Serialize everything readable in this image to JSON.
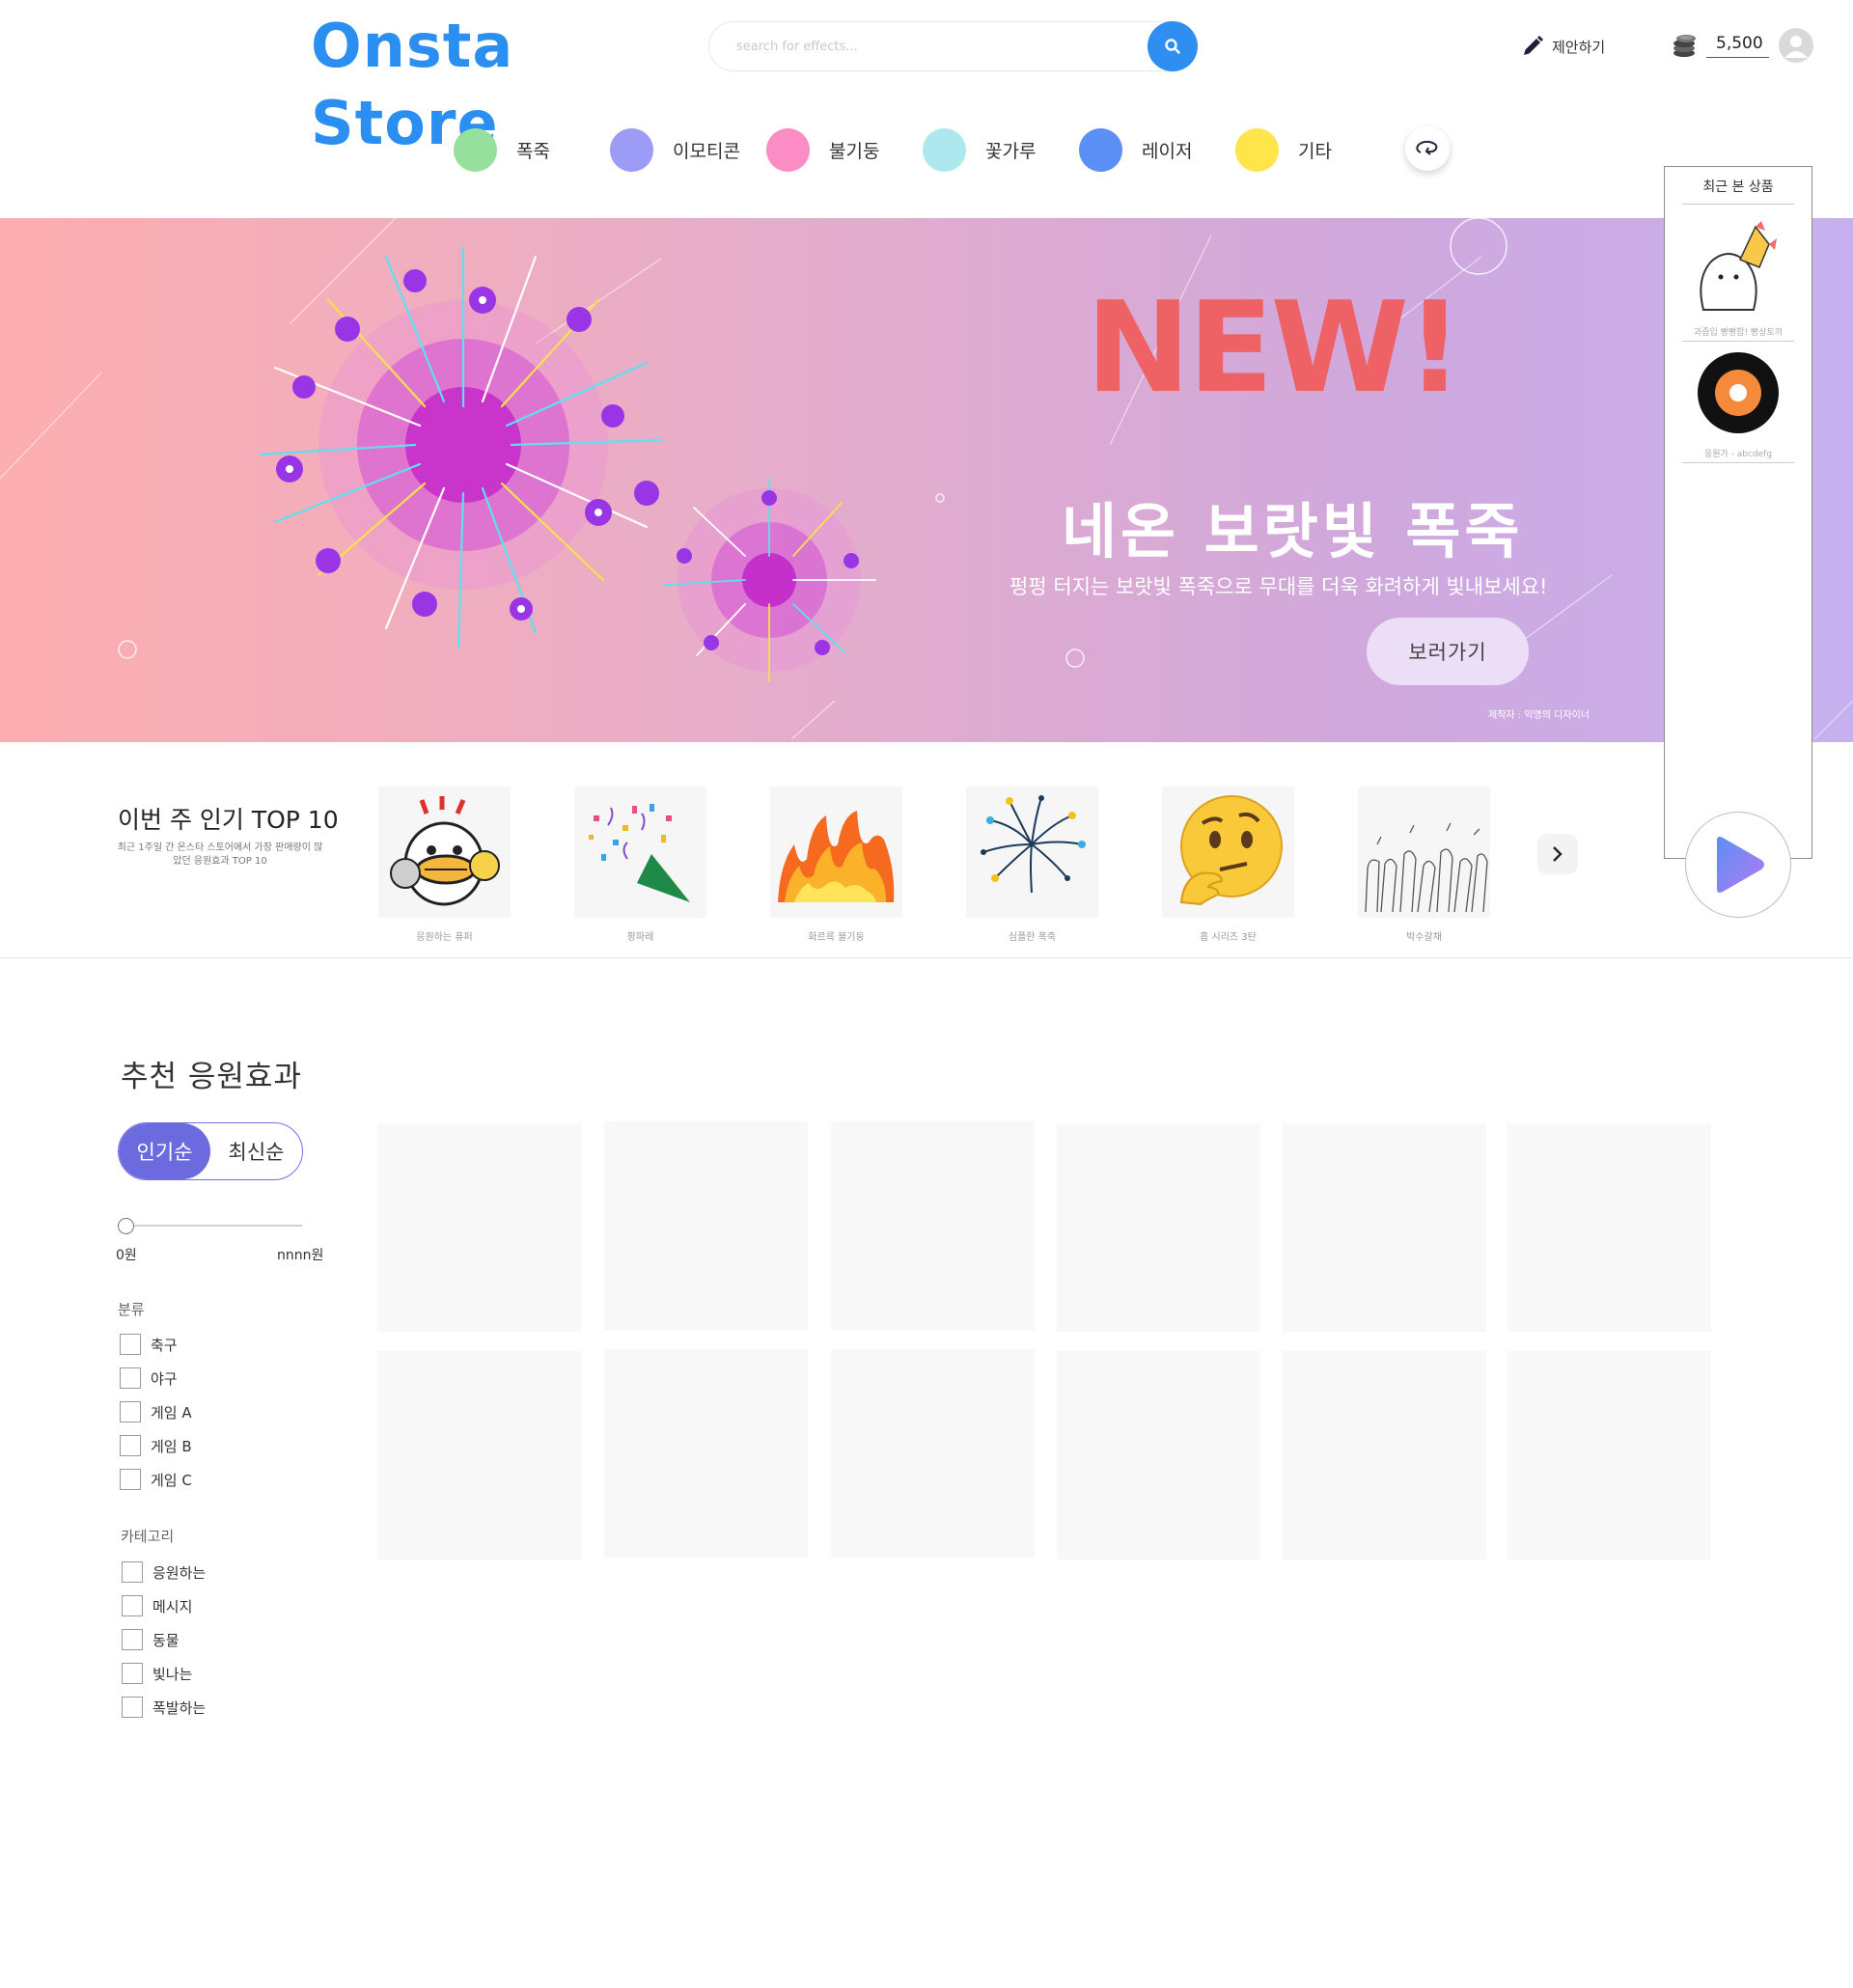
{
  "header": {
    "logo": "Onsta Store",
    "search_placeholder": "search for effects...",
    "suggest_label": "제안하기",
    "coin_balance": "5,500"
  },
  "categories": [
    {
      "label": "폭죽",
      "color": "#94e09c"
    },
    {
      "label": "이모티콘",
      "color": "#9c9bf5"
    },
    {
      "label": "불기둥",
      "color": "#fb8dc4"
    },
    {
      "label": "꽃가루",
      "color": "#ace8ee"
    },
    {
      "label": "레이저",
      "color": "#5a8ff5"
    },
    {
      "label": "기타",
      "color": "#ffe44a"
    }
  ],
  "banner": {
    "headline": "NEW!",
    "title": "네온 보랏빛 폭죽",
    "subtitle": "펑펑 터지는 보랏빛 폭죽으로 무대를 더욱 화려하게 빛내보세요!",
    "button": "보러가기",
    "credit": "제작자 : 익명의 디자이너"
  },
  "top10": {
    "title": "이번 주 인기 TOP 10",
    "description": "최근 1주일 간 온스타 스토어에서 가장 판매량이 많았던 응원효과 TOP 10",
    "items": [
      {
        "label": "응원하는 퓨퍼",
        "icon": "cheering-duck-icon"
      },
      {
        "label": "팡파레",
        "icon": "party-popper-icon"
      },
      {
        "label": "화르륵 불기둥",
        "icon": "fire-icon"
      },
      {
        "label": "심플한 폭죽",
        "icon": "firework-icon"
      },
      {
        "label": "흠 시리즈 3탄",
        "icon": "thinking-face-icon"
      },
      {
        "label": "박수갈채",
        "icon": "clapping-hands-icon"
      }
    ]
  },
  "recent": {
    "title": "최근 본 상품",
    "items": [
      {
        "label": "과즙입 빵빵함! 빵상토끼",
        "icon": "bunny-icon"
      },
      {
        "label": "응원가 - abcdefg",
        "icon": "vinyl-record-icon"
      }
    ]
  },
  "recommend": {
    "title": "추천 응원효과",
    "sort_popular": "인기순",
    "sort_latest": "최신순",
    "price_min": "0원",
    "price_max": "nnnn원",
    "group1_title": "분류",
    "group1_items": [
      "축구",
      "야구",
      "게임 A",
      "게임 B",
      "게임 C"
    ],
    "group2_title": "카테고리",
    "group2_items": [
      "응원하는",
      "메시지",
      "동물",
      "빛나는",
      "폭발하는"
    ]
  },
  "colors": {
    "brand": "#2f8ff0",
    "accent": "#6c6adf",
    "new_red": "#ee6165"
  }
}
